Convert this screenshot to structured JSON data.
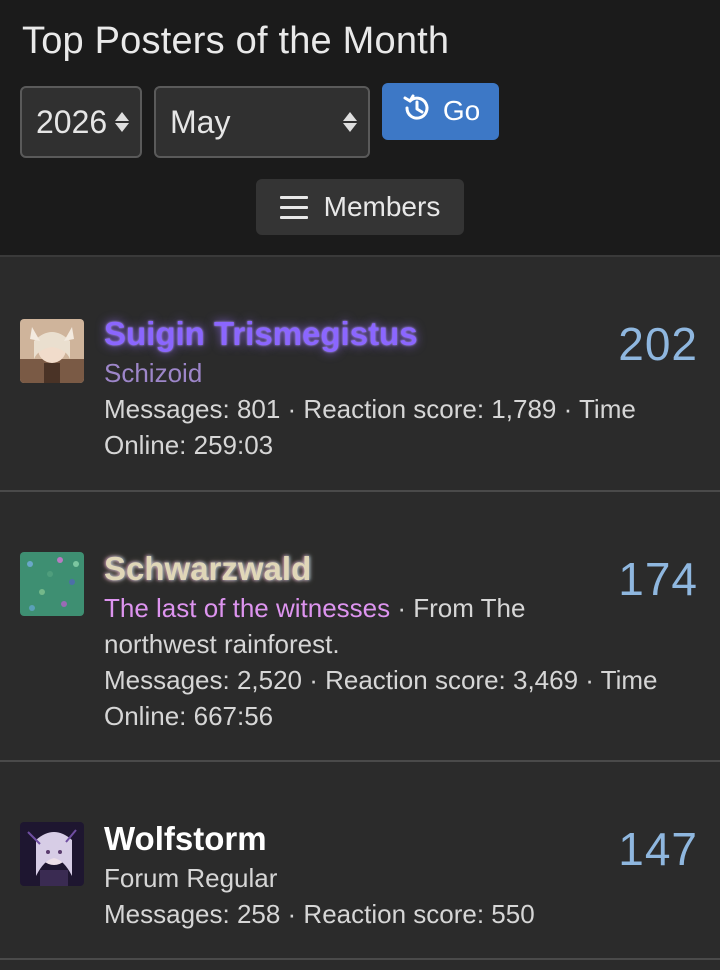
{
  "header": {
    "title": "Top Posters of the Month",
    "year_select": {
      "value": "2026"
    },
    "month_select": {
      "value": "May"
    },
    "go_label": "Go",
    "members_label": "Members"
  },
  "colors": {
    "accent_button": "#3d78c6",
    "count_color": "#8fb7df"
  },
  "posters": [
    {
      "username": "Suigin Trismegistus",
      "user_title": "Schizoid",
      "location_sep": "",
      "location": "",
      "stats_line1": "Messages: 801 · Reaction score: 1,789 · Time",
      "stats_line2": "Online: 259:03",
      "count": "202"
    },
    {
      "username": "Schwarzwald",
      "user_title": "The last of the witnesses",
      "location_sep": " · ",
      "location": "From The",
      "location_line2": "northwest rainforest.",
      "stats_line1": "Messages: 2,520 · Reaction score: 3,469 · Time",
      "stats_line2": "Online: 667:56",
      "count": "174"
    },
    {
      "username": "Wolfstorm",
      "user_title": "Forum Regular",
      "stats_line1": "Messages: 258 · Reaction score: 550",
      "count": "147"
    }
  ]
}
